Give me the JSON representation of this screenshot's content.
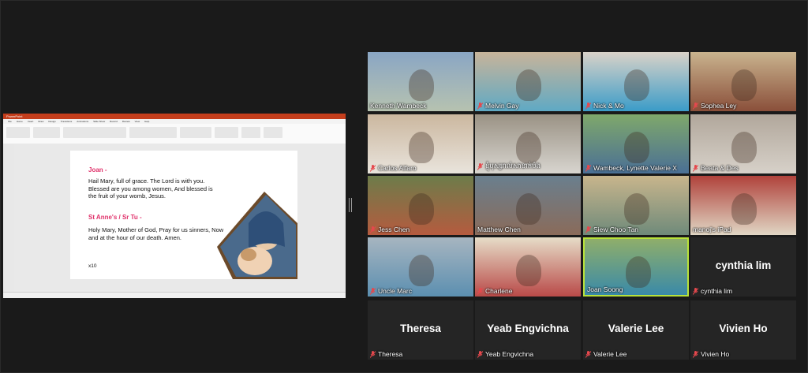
{
  "shared_screen": {
    "app_title": "PowerPoint",
    "ribbon_tabs": [
      "File",
      "Home",
      "Insert",
      "Draw",
      "Design",
      "Transitions",
      "Animations",
      "Slide Show",
      "Record",
      "Review",
      "View",
      "Help"
    ],
    "slide": {
      "heading1": "Joan -",
      "text1": "Hail Mary, full of grace. The Lord is with you. Blessed are you among women, And blessed is the fruit of your womb, Jesus.",
      "heading2": "St Anne's / Sr Tu -",
      "text2": "Holy Mary, Mother of God, Pray for us sinners, Now and at the hour of our death. Amen.",
      "count": "x10"
    }
  },
  "participants": [
    {
      "name": "Kenneth Wambeck",
      "muted": false,
      "video": true,
      "colors": [
        "#8aa6c4",
        "#b6c2b0"
      ]
    },
    {
      "name": "Melvin Gay",
      "muted": true,
      "video": true,
      "colors": [
        "#c8b49a",
        "#5fa9c4"
      ]
    },
    {
      "name": "Nick & Mo",
      "muted": true,
      "video": true,
      "colors": [
        "#d9d2c8",
        "#3b9cc8"
      ]
    },
    {
      "name": "Sophea Ley",
      "muted": true,
      "video": true,
      "colors": [
        "#c9b38e",
        "#8a4f3a"
      ]
    },
    {
      "name": "Carlos Alfaro",
      "muted": true,
      "video": true,
      "colors": [
        "#cbb79f",
        "#e9e4dc"
      ]
    },
    {
      "name": "ខ្ញុំបុស្សរាល់សាខាក់ប៉ង",
      "muted": true,
      "video": true,
      "colors": [
        "#9a9284",
        "#d8d5cf"
      ]
    },
    {
      "name": "Wambeck, Lynette Valerie X",
      "muted": true,
      "video": true,
      "colors": [
        "#7fa86b",
        "#4a6f95"
      ]
    },
    {
      "name": "Beata & Des",
      "muted": true,
      "video": true,
      "colors": [
        "#b1a79b",
        "#d7d1c9"
      ]
    },
    {
      "name": "Jess Chen",
      "muted": true,
      "video": true,
      "colors": [
        "#6d7c4a",
        "#b55b3f"
      ]
    },
    {
      "name": "Matthew Chen",
      "muted": false,
      "video": true,
      "colors": [
        "#6a7f8e",
        "#8a6b5a"
      ]
    },
    {
      "name": "Siew Choo Tan",
      "muted": true,
      "video": true,
      "colors": [
        "#c8b58c",
        "#6f8a7a"
      ]
    },
    {
      "name": "manoj's iPad",
      "muted": false,
      "video": true,
      "colors": [
        "#b0423b",
        "#e0d6c4"
      ]
    },
    {
      "name": "Uncle Marc",
      "muted": true,
      "video": true,
      "colors": [
        "#a7b5c0",
        "#5c8fb0"
      ]
    },
    {
      "name": "Charlene",
      "muted": true,
      "video": true,
      "colors": [
        "#e6ddc8",
        "#b94a48"
      ]
    },
    {
      "name": "Joan Soong",
      "muted": false,
      "video": true,
      "active_speaker": true,
      "colors": [
        "#8fae6a",
        "#3a8aa8"
      ]
    },
    {
      "name": "cynthia lim",
      "muted": true,
      "video": false
    },
    {
      "name": "Theresa",
      "muted": true,
      "video": false
    },
    {
      "name": "Yeab Engvichna",
      "muted": true,
      "video": false
    },
    {
      "name": "Valerie Lee",
      "muted": true,
      "video": false
    },
    {
      "name": "Vivien Ho",
      "muted": true,
      "video": false
    }
  ],
  "colors": {
    "active_speaker_border": "#b8e23a",
    "muted_mic": "#e5484d",
    "background": "#1a1a1a"
  }
}
